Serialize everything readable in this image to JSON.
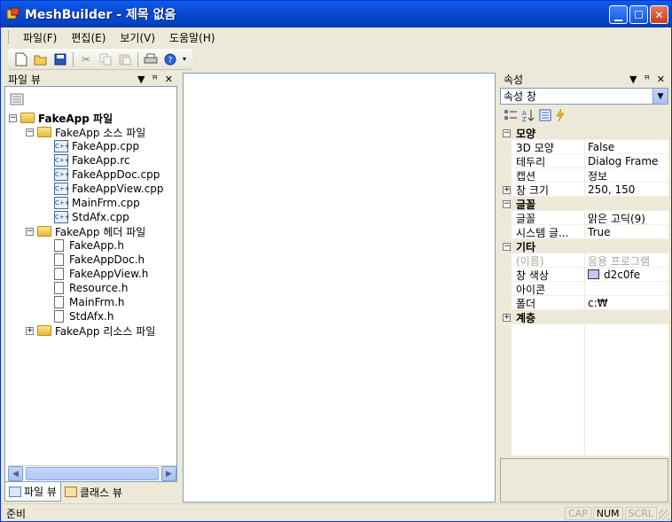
{
  "window": {
    "title": "MeshBuilder - 제목 없음"
  },
  "menu": [
    "파일(F)",
    "편집(E)",
    "보기(V)",
    "도움말(H)"
  ],
  "toolbar": {
    "icons": [
      "new-file-icon",
      "open-folder-icon",
      "save-icon",
      "cut-icon",
      "copy-icon",
      "paste-icon",
      "print-icon",
      "help-icon"
    ]
  },
  "file_view": {
    "title": "파일 뷰",
    "tree": [
      {
        "label": "FakeApp 파일",
        "type": "folder",
        "level": 0,
        "expanded": true,
        "bold": true
      },
      {
        "label": "FakeApp 소스 파일",
        "type": "folder",
        "level": 1,
        "expanded": true
      },
      {
        "label": "FakeApp.cpp",
        "type": "cpp",
        "level": 2
      },
      {
        "label": "FakeApp.rc",
        "type": "cpp",
        "level": 2
      },
      {
        "label": "FakeAppDoc.cpp",
        "type": "cpp",
        "level": 2
      },
      {
        "label": "FakeAppView.cpp",
        "type": "cpp",
        "level": 2
      },
      {
        "label": "MainFrm.cpp",
        "type": "cpp",
        "level": 2
      },
      {
        "label": "StdAfx.cpp",
        "type": "cpp",
        "level": 2
      },
      {
        "label": "FakeApp 헤더 파일",
        "type": "folder",
        "level": 1,
        "expanded": true
      },
      {
        "label": "FakeApp.h",
        "type": "file",
        "level": 2
      },
      {
        "label": "FakeAppDoc.h",
        "type": "file",
        "level": 2
      },
      {
        "label": "FakeAppView.h",
        "type": "file",
        "level": 2
      },
      {
        "label": "Resource.h",
        "type": "file",
        "level": 2
      },
      {
        "label": "MainFrm.h",
        "type": "file",
        "level": 2
      },
      {
        "label": "StdAfx.h",
        "type": "file",
        "level": 2
      },
      {
        "label": "FakeApp 리소스 파일",
        "type": "folder",
        "level": 1,
        "expanded": false
      }
    ],
    "tabs": [
      "파일 뷰",
      "클래스 뷰"
    ]
  },
  "properties": {
    "title": "속성",
    "combo": "속성 창",
    "rows": [
      {
        "kind": "cat",
        "name": "모양",
        "exp": "−"
      },
      {
        "kind": "prop",
        "name": "3D 모양",
        "value": "False"
      },
      {
        "kind": "prop",
        "name": "테두리",
        "value": "Dialog Frame"
      },
      {
        "kind": "prop",
        "name": "캡션",
        "value": "정보"
      },
      {
        "kind": "prop",
        "name": "창 크기",
        "value": "250, 150",
        "exp": "+"
      },
      {
        "kind": "cat",
        "name": "글꼴",
        "exp": "−"
      },
      {
        "kind": "prop",
        "name": "글꼴",
        "value": "맑은 고딕(9)"
      },
      {
        "kind": "prop",
        "name": "시스템 글...",
        "value": "True"
      },
      {
        "kind": "cat",
        "name": "기타",
        "exp": "−"
      },
      {
        "kind": "prop",
        "name": "(이름)",
        "value": "응용 프로그램",
        "disabled": true
      },
      {
        "kind": "prop",
        "name": "창 색상",
        "value": "d2c0fe",
        "swatch": "#d2c0fe"
      },
      {
        "kind": "prop",
        "name": "아이콘",
        "value": ""
      },
      {
        "kind": "prop",
        "name": "폴더",
        "value": "c:₩"
      },
      {
        "kind": "cat",
        "name": "계층",
        "exp": "+"
      }
    ]
  },
  "status": {
    "text": "준비",
    "indicators": [
      {
        "label": "CAP",
        "on": false
      },
      {
        "label": "NUM",
        "on": true
      },
      {
        "label": "SCRL",
        "on": false
      }
    ]
  }
}
